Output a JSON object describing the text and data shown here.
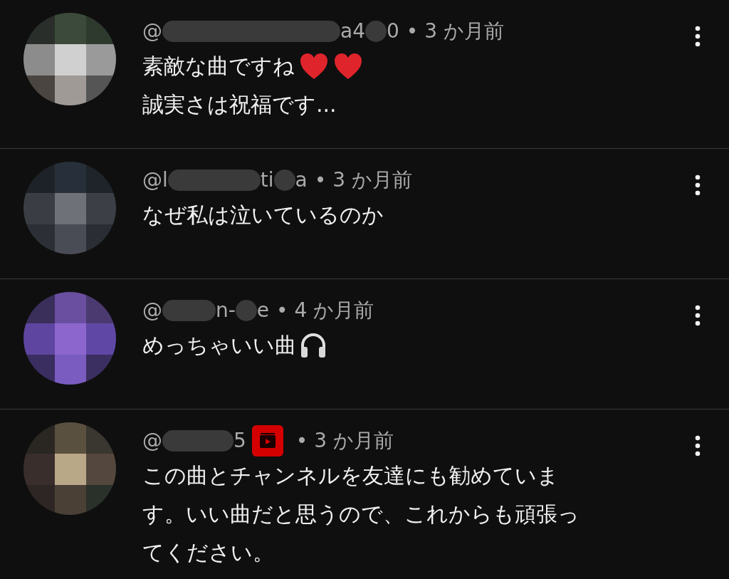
{
  "comments": [
    {
      "handle_parts": [
        "@",
        "a4",
        "0"
      ],
      "member_badge": false,
      "meta": "• 3 か月前",
      "lines": [
        {
          "text": "素敵な曲ですね",
          "icons": [
            {
              "kind": "heart"
            },
            {
              "kind": "heart"
            }
          ]
        },
        {
          "text": "誠実さは祝福です..."
        }
      ]
    },
    {
      "handle_parts": [
        "@l",
        "ti",
        "a"
      ],
      "member_badge": false,
      "meta": "• 3 か月前",
      "lines": [
        {
          "text": "なぜ私は泣いているのか"
        }
      ]
    },
    {
      "handle_parts": [
        "@",
        "n-",
        "e"
      ],
      "member_badge": false,
      "meta": "• 4 か月前",
      "lines": [
        {
          "text": "めっちゃいい曲",
          "icons": [
            {
              "kind": "headphones"
            }
          ]
        }
      ]
    },
    {
      "handle_parts": [
        "@",
        "5"
      ],
      "member_badge": true,
      "meta": "• 3 か月前",
      "lines": [
        {
          "text": "この曲とチャンネルを友達にも勧めていま"
        },
        {
          "text": "す。いい曲だと思うので、これからも頑張っ"
        },
        {
          "text": "てください。"
        }
      ]
    }
  ]
}
